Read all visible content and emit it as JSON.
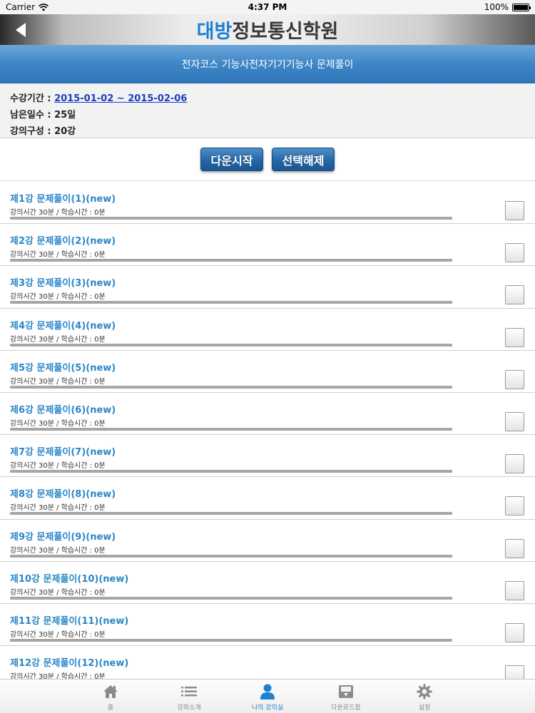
{
  "status_bar": {
    "carrier": "Carrier",
    "time": "4:37 PM",
    "battery": "100%"
  },
  "nav": {
    "title_brand": "대방",
    "title_rest": "정보통신학원"
  },
  "course": {
    "title": "전자코스 기능사전자기기기능사 문제풀이"
  },
  "info": {
    "period_label": "수강기간 : ",
    "period_value": "2015-01-02 ~ 2015-02-06",
    "remaining": "남은일수 : 25일",
    "composition": "강의구성 : 20강"
  },
  "buttons": {
    "start_download": "다운시작",
    "deselect": "선택해제"
  },
  "lectures": [
    {
      "title": "제1강 문제풀이(1)(new)",
      "meta": "강의시간 30분 / 학습시간 : 0분",
      "progress": 0
    },
    {
      "title": "제2강 문제풀이(2)(new)",
      "meta": "강의시간 30분 / 학습시간 : 0분",
      "progress": 0
    },
    {
      "title": "제3강 문제풀이(3)(new)",
      "meta": "강의시간 30분 / 학습시간 : 0분",
      "progress": 0
    },
    {
      "title": "제4강 문제풀이(4)(new)",
      "meta": "강의시간 30분 / 학습시간 : 0분",
      "progress": 0
    },
    {
      "title": "제5강 문제풀이(5)(new)",
      "meta": "강의시간 30분 / 학습시간 : 0분",
      "progress": 0
    },
    {
      "title": "제6강 문제풀이(6)(new)",
      "meta": "강의시간 30분 / 학습시간 : 0분",
      "progress": 0
    },
    {
      "title": "제7강 문제풀이(7)(new)",
      "meta": "강의시간 30분 / 학습시간 : 0분",
      "progress": 0
    },
    {
      "title": "제8강 문제풀이(8)(new)",
      "meta": "강의시간 30분 / 학습시간 : 0분",
      "progress": 0
    },
    {
      "title": "제9강 문제풀이(9)(new)",
      "meta": "강의시간 30분 / 학습시간 : 0분",
      "progress": 0
    },
    {
      "title": "제10강 문제풀이(10)(new)",
      "meta": "강의시간 30분 / 학습시간 : 0분",
      "progress": 0
    },
    {
      "title": "제11강 문제풀이(11)(new)",
      "meta": "강의시간 30분 / 학습시간 : 0분",
      "progress": 0
    },
    {
      "title": "제12강 문제풀이(12)(new)",
      "meta": "강의시간 30분 / 학습시간 : 0분",
      "progress": 0
    }
  ],
  "tabs": [
    {
      "label": "홈",
      "icon": "home-icon"
    },
    {
      "label": "강좌소개",
      "icon": "list-icon"
    },
    {
      "label": "나의 강의실",
      "icon": "person-icon",
      "active": true
    },
    {
      "label": "다운로드함",
      "icon": "download-box-icon"
    },
    {
      "label": "설정",
      "icon": "gear-icon"
    }
  ],
  "colors": {
    "accent": "#1f7fd0",
    "header_blue": "#3f86c7",
    "lecture_title": "#2a87c8"
  }
}
